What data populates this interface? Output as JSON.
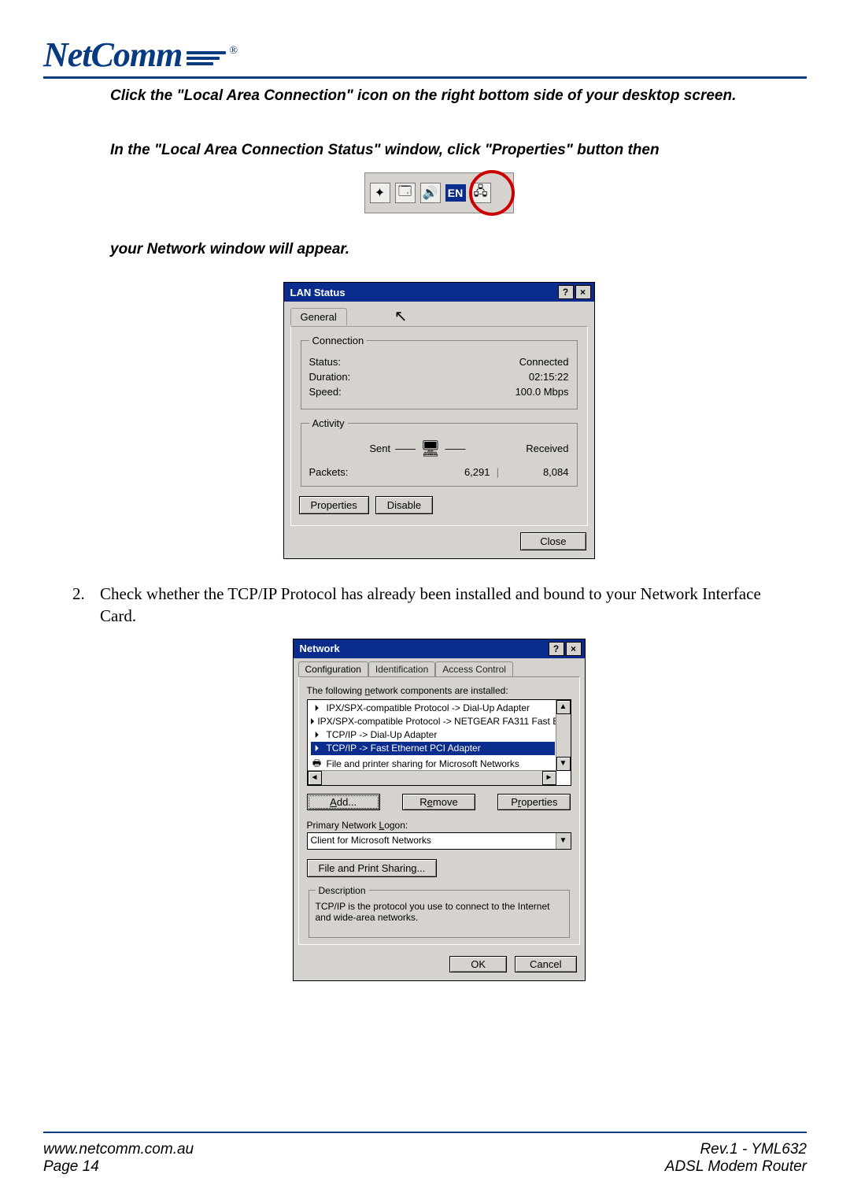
{
  "header": {
    "logo_text": "NetComm",
    "registered": "®"
  },
  "instructions": {
    "p1": "Click the \"Local Area Connection\" icon on the right bottom side of your desktop screen.",
    "p2": "In the \"Local Area Connection Status\" window, click \"Properties\" button then",
    "p3": "your Network window will appear."
  },
  "systray": {
    "lang_indicator": "EN"
  },
  "lan_status": {
    "title": "LAN Status",
    "help_glyph": "?",
    "close_glyph": "×",
    "tab_general": "General",
    "connection": {
      "legend": "Connection",
      "status_label": "Status:",
      "status_value": "Connected",
      "duration_label": "Duration:",
      "duration_value": "02:15:22",
      "speed_label": "Speed:",
      "speed_value": "100.0 Mbps"
    },
    "activity": {
      "legend": "Activity",
      "sent_label": "Sent",
      "received_label": "Received",
      "packets_label": "Packets:",
      "sent_value": "6,291",
      "received_value": "8,084"
    },
    "buttons": {
      "properties": "Properties",
      "disable": "Disable",
      "close": "Close"
    }
  },
  "step2": {
    "number": "2.",
    "text": "Check whether the TCP/IP Protocol has already been installed and bound to your Network Interface Card."
  },
  "network": {
    "title": "Network",
    "help_glyph": "?",
    "close_glyph": "×",
    "tabs": {
      "configuration": "Configuration",
      "identification": "Identification",
      "access_control": "Access Control"
    },
    "list_label_pre": "The following ",
    "list_label_ul": "n",
    "list_label_post": "etwork components are installed:",
    "items": [
      "IPX/SPX-compatible Protocol -> Dial-Up Adapter",
      "IPX/SPX-compatible Protocol -> NETGEAR FA311 Fast E",
      "TCP/IP -> Dial-Up Adapter",
      "TCP/IP -> Fast Ethernet PCI Adapter",
      "File and printer sharing for Microsoft Networks"
    ],
    "selected_index": 3,
    "buttons": {
      "add_ul": "A",
      "add_rest": "dd...",
      "remove_pre": "R",
      "remove_ul": "e",
      "remove_post": "move",
      "properties_pre": "P",
      "properties_ul": "r",
      "properties_post": "operties",
      "fps_ul": "F",
      "fps_rest": "ile and Print Sharing...",
      "ok": "OK",
      "cancel": "Cancel"
    },
    "primary_logon": {
      "label_pre": "Primary Network ",
      "label_ul": "L",
      "label_post": "ogon:",
      "value": "Client for Microsoft Networks"
    },
    "description": {
      "legend": "Description",
      "text": "TCP/IP is the protocol you use to connect to the Internet and wide-area networks."
    }
  },
  "footer": {
    "url": "www.netcomm.com.au",
    "page": "Page 14",
    "rev": "Rev.1 - YML632",
    "product": "ADSL Modem Router"
  }
}
